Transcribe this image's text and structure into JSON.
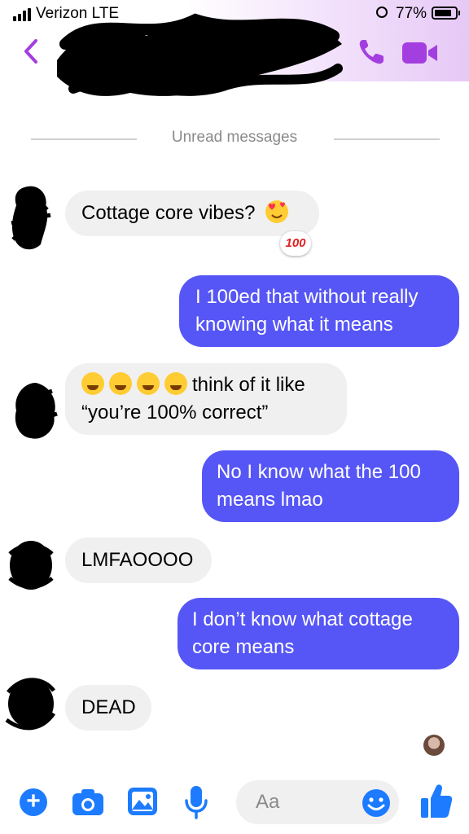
{
  "status_bar": {
    "carrier": "Verizon",
    "network": "LTE",
    "battery_percent": "77%"
  },
  "header": {
    "back_icon": "chevron-left-icon",
    "call_icon": "phone-icon",
    "video_icon": "video-icon",
    "accent": "#a33ee0"
  },
  "divider": {
    "label": "Unread messages"
  },
  "messages": [
    {
      "direction": "incoming",
      "text": "Cottage core vibes?",
      "emoji": [
        "smiling-face-with-hearts"
      ],
      "reaction": "100"
    },
    {
      "direction": "outgoing",
      "lines": [
        "I 100ed that without really",
        "knowing what it means"
      ]
    },
    {
      "direction": "incoming",
      "emoji_prefix": [
        "tears-of-joy",
        "tears-of-joy",
        "tears-of-joy",
        "tears-of-joy"
      ],
      "lines": [
        "think of it like",
        "“you’re 100% correct”"
      ]
    },
    {
      "direction": "outgoing",
      "lines": [
        "No I know what the 100",
        "means lmao"
      ]
    },
    {
      "direction": "incoming",
      "text": "LMFAOOOO"
    },
    {
      "direction": "outgoing",
      "lines": [
        "I don’t know what cottage",
        "core means"
      ]
    },
    {
      "direction": "incoming",
      "text": "DEAD"
    }
  ],
  "composer": {
    "placeholder": "Aa",
    "plus_icon": "plus-icon",
    "camera_icon": "camera-icon",
    "gallery_icon": "image-icon",
    "mic_icon": "microphone-icon",
    "emoji_icon": "smiley-icon",
    "like_icon": "thumbs-up-icon",
    "accent": "#1c7bff"
  },
  "colors": {
    "incoming_bubble": "#f0f0f0",
    "outgoing_bubble": "#5656f6"
  }
}
